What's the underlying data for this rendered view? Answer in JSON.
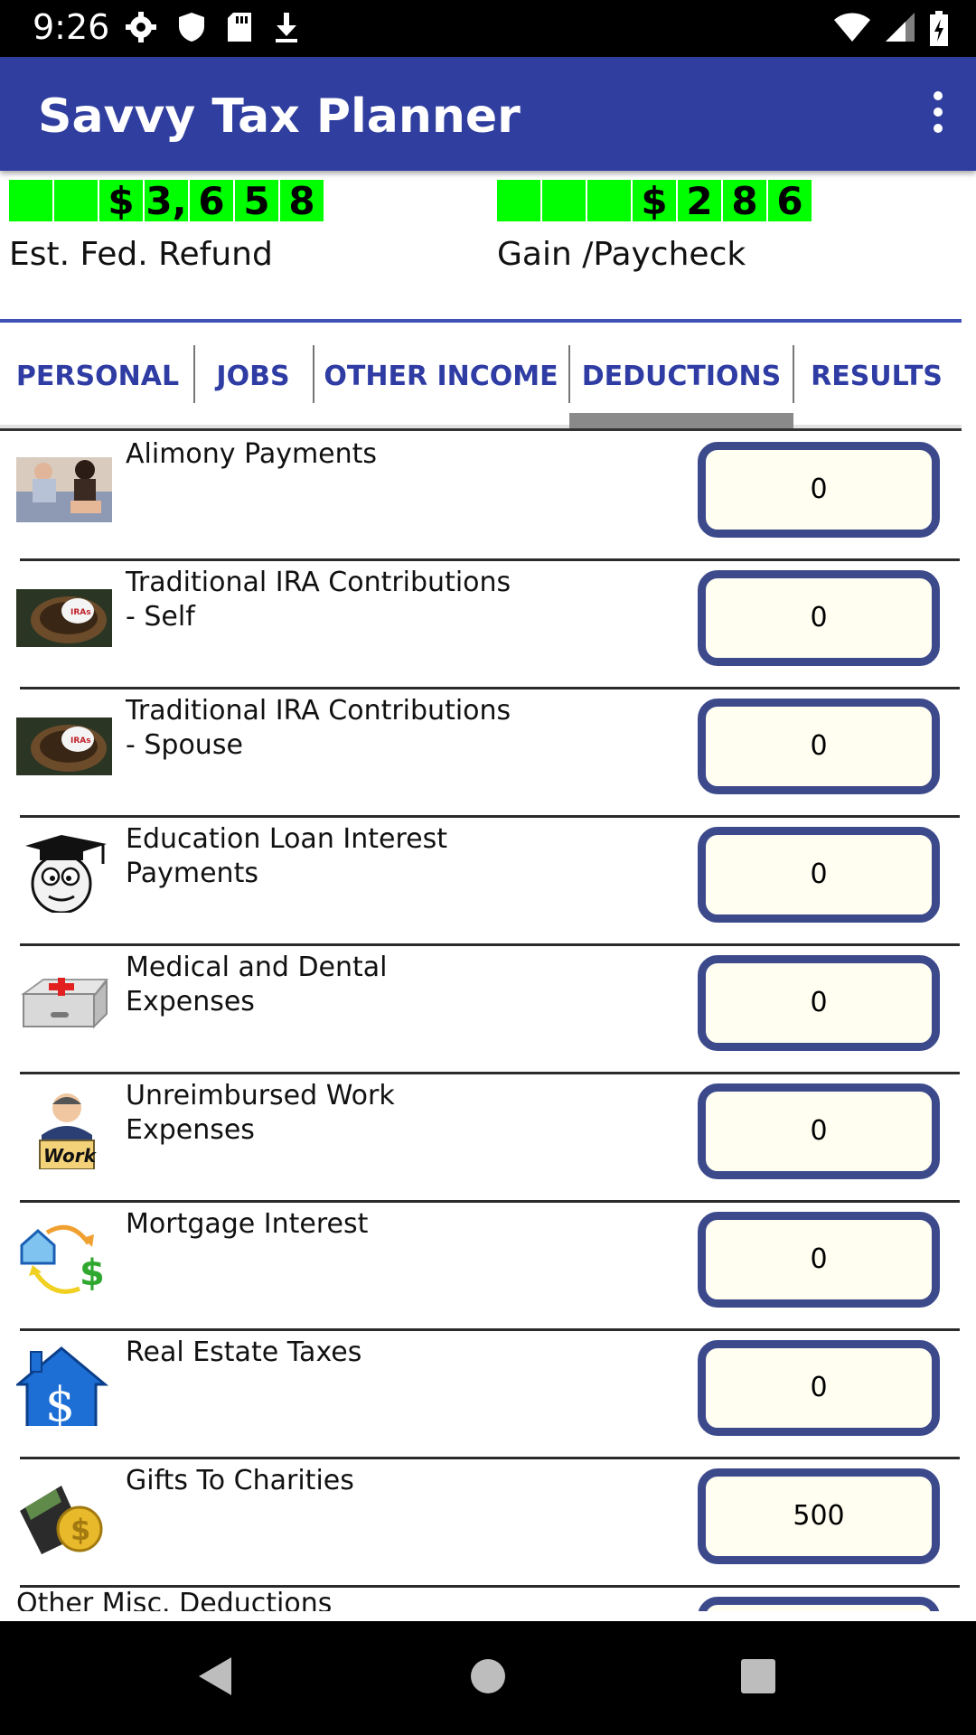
{
  "status_bar": {
    "time": "9:26"
  },
  "app_bar": {
    "title": "Savvy Tax Planner"
  },
  "summary": {
    "refund": {
      "digits": [
        "",
        "",
        "$",
        "3,",
        "6",
        "5",
        "8"
      ],
      "label": "Est. Fed. Refund"
    },
    "paycheck": {
      "digits": [
        "",
        "",
        "",
        "$",
        "2",
        "8",
        "6"
      ],
      "label": "Gain /Paycheck"
    }
  },
  "tabs": [
    {
      "label": "PERSONAL"
    },
    {
      "label": "JOBS"
    },
    {
      "label": "OTHER INCOME"
    },
    {
      "label": "DEDUCTIONS"
    },
    {
      "label": "RESULTS"
    }
  ],
  "active_tab": "DEDUCTIONS",
  "deductions": [
    {
      "label": "Alimony Payments",
      "value": "0",
      "icon": "couple-photo-icon"
    },
    {
      "label": "Traditional IRA Contributions - Self",
      "value": "0",
      "icon": "nest-egg-icon"
    },
    {
      "label": "Traditional IRA Contributions - Spouse",
      "value": "0",
      "icon": "nest-egg-icon"
    },
    {
      "label": "Education Loan Interest Payments",
      "value": "0",
      "icon": "graduate-icon"
    },
    {
      "label": "Medical and Dental Expenses",
      "value": "0",
      "icon": "first-aid-kit-icon"
    },
    {
      "label": "Unreimbursed Work Expenses",
      "value": "0",
      "icon": "worker-icon"
    },
    {
      "label": "Mortgage Interest",
      "value": "0",
      "icon": "house-dollar-cycle-icon"
    },
    {
      "label": "Real Estate Taxes",
      "value": "0",
      "icon": "house-dollar-icon"
    },
    {
      "label": "Gifts To Charities",
      "value": "500",
      "icon": "wallet-coin-icon"
    },
    {
      "label": "Other Misc. Deductions",
      "value": "",
      "icon": ""
    }
  ],
  "colors": {
    "app_bar": "#303f9f",
    "counter_green": "#00ff00",
    "field_border": "#3c4a8c",
    "field_bg": "#fffef0",
    "tab_text": "#2e3ca3"
  }
}
